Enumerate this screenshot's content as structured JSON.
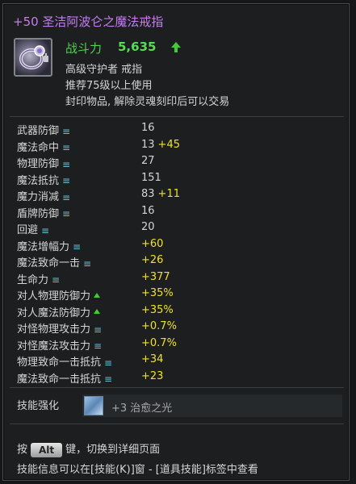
{
  "item": {
    "title": "+50 圣洁阿波仑之魔法戒指",
    "power_label": "战斗力",
    "power_value": "5,635",
    "type_line": "高级守护者 戒指",
    "level_line": "推荐75级以上使用",
    "seal_line": "封印物品, 解除灵魂刻印后可以交易"
  },
  "stats": [
    {
      "name": "武器防御",
      "marker": "eq",
      "value": "16",
      "bonus": ""
    },
    {
      "name": "魔法命中",
      "marker": "eq",
      "value": "13",
      "bonus": "+45"
    },
    {
      "name": "物理防御",
      "marker": "eq",
      "value": "27",
      "bonus": ""
    },
    {
      "name": "魔法抵抗",
      "marker": "eq",
      "value": "151",
      "bonus": ""
    },
    {
      "name": "魔力消减",
      "marker": "eq",
      "value": "83",
      "bonus": "+11"
    },
    {
      "name": "盾牌防御",
      "marker": "eq",
      "value": "16",
      "bonus": ""
    },
    {
      "name": "回避",
      "marker": "eq",
      "value": "20",
      "bonus": ""
    },
    {
      "name": "魔法增幅力",
      "marker": "eq",
      "value": "+60",
      "bonus": ""
    },
    {
      "name": "魔法致命一击",
      "marker": "eq",
      "value": "+26",
      "bonus": ""
    },
    {
      "name": "生命力",
      "marker": "eq",
      "value": "+377",
      "bonus": ""
    },
    {
      "name": "对人物理防御力",
      "marker": "arrow",
      "value": "+35%",
      "bonus": ""
    },
    {
      "name": "对人魔法防御力",
      "marker": "arrow",
      "value": "+35%",
      "bonus": ""
    },
    {
      "name": "对怪物理攻击力",
      "marker": "eq",
      "value": "+0.7%",
      "bonus": ""
    },
    {
      "name": "对怪魔法攻击力",
      "marker": "eq",
      "value": "+0.7%",
      "bonus": ""
    },
    {
      "name": "物理致命一击抵抗",
      "marker": "eq",
      "value": "+34",
      "bonus": ""
    },
    {
      "name": "魔法致命一击抵抗",
      "marker": "eq",
      "value": "+23",
      "bonus": ""
    }
  ],
  "skill": {
    "label": "技能强化",
    "text": "+3 治愈之光"
  },
  "footer": {
    "alt_prefix": "按",
    "alt_key": "Alt",
    "alt_suffix": "键，切换到详细页面",
    "skill_info": "技能信息可以在[技能(K)]窗 - [道具技能]标签中查看"
  },
  "icons": {
    "item_icon": "ring-icon",
    "power_trend": "up-arrow-icon",
    "stat_marker": "equal-icon",
    "stat_marker_alt": "up-arrow-icon",
    "skill_icon": "healing-light-icon"
  },
  "colors": {
    "title": "#c77cf2",
    "power": "#55dd55",
    "bonus": "#f0e12d"
  }
}
